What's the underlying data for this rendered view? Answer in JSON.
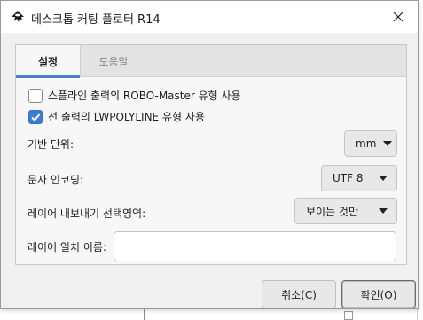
{
  "window": {
    "title": "데스크톱 커팅 플로터 R14",
    "close_icon": "close-icon",
    "app_icon": "inkscape-icon"
  },
  "tabs": [
    {
      "label": "설정",
      "active": true
    },
    {
      "label": "도움말",
      "active": false
    }
  ],
  "options": {
    "spline_robo": {
      "label": "스플라인 출력의 ROBO-Master 유형 사용",
      "checked": false
    },
    "lwpolyline": {
      "label": "선 출력의 LWPOLYLINE 유형 사용",
      "checked": true
    }
  },
  "base_unit": {
    "label": "기반 단위:",
    "value": "mm"
  },
  "encoding": {
    "label": "문자 인코딩:",
    "value": "UTF 8"
  },
  "layer_export": {
    "label": "레이어 내보내기 선택영역:",
    "value": "보이는 것만"
  },
  "layer_match": {
    "label": "레이어 일치 이름:",
    "value": ""
  },
  "buttons": {
    "cancel": "취소(C)",
    "ok": "확인(O)"
  },
  "colors": {
    "accent": "#3e7bd1",
    "tab_underline": "#4a7fc4"
  }
}
